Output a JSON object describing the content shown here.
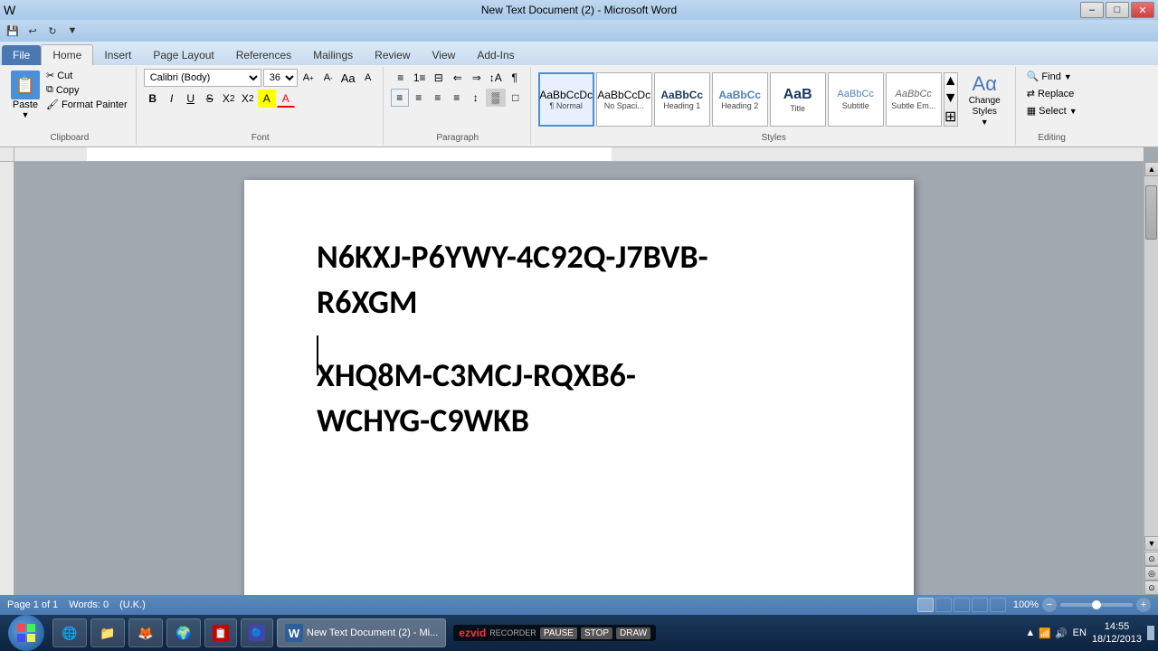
{
  "window": {
    "title": "New Text Document (2) - Microsoft Word",
    "min": "–",
    "max": "□",
    "close": "✕"
  },
  "quickaccess": {
    "items": [
      "💾",
      "↩",
      "↻",
      "▼"
    ]
  },
  "ribbon": {
    "tabs": [
      "File",
      "Home",
      "Insert",
      "Page Layout",
      "References",
      "Mailings",
      "Review",
      "View",
      "Add-Ins"
    ],
    "active_tab": "Home",
    "groups": {
      "clipboard": {
        "label": "Clipboard",
        "paste_label": "Paste",
        "cut": "Cut",
        "copy": "Copy",
        "format_painter": "Format Painter"
      },
      "font": {
        "label": "Font",
        "font_name": "Calibri (Body)",
        "font_size": "36",
        "grow": "A",
        "shrink": "a",
        "clear": "✕",
        "bold": "B",
        "italic": "I",
        "underline": "U",
        "strikethrough": "S",
        "subscript": "x₂",
        "superscript": "x²",
        "highlight": "A",
        "color": "A"
      },
      "paragraph": {
        "label": "Paragraph",
        "bullets": "☰",
        "numbering": "☷",
        "multilevel": "☰",
        "decrease_indent": "←",
        "increase_indent": "→",
        "sort": "↕",
        "show_hide": "¶",
        "align_left": "≡",
        "align_center": "≡",
        "align_right": "≡",
        "justify": "≡",
        "line_spacing": "↕",
        "shading": "▒",
        "borders": "□"
      },
      "styles": {
        "label": "Styles",
        "items": [
          {
            "label": "Normal",
            "preview": "AaBbCcDc",
            "active": true
          },
          {
            "label": "No Spaci...",
            "preview": "AaBbCcDc",
            "active": false
          },
          {
            "label": "Heading 1",
            "preview": "AaBbCc",
            "active": false
          },
          {
            "label": "Heading 2",
            "preview": "AaBbCc",
            "active": false
          },
          {
            "label": "Title",
            "preview": "AaB",
            "active": false
          },
          {
            "label": "Subtitle",
            "preview": "AaBbCc",
            "active": false
          },
          {
            "label": "Subtle Em...",
            "preview": "AaBbCc",
            "active": false
          }
        ],
        "change_styles": "Change\nStyles",
        "expand_arrow": "▼"
      },
      "editing": {
        "label": "Editing",
        "find": "Find",
        "replace": "Replace",
        "select": "Select"
      }
    }
  },
  "document": {
    "content_line1": "N6KXJ-P6YWY-4C92Q-J7BVB-",
    "content_line2": "R6XGM",
    "content_line3": "",
    "content_line4": "XHQ8M-C3MCJ-RQXB6-",
    "content_line5": "WCHYG-C9WKB"
  },
  "status": {
    "page": "Page 1 of 1",
    "words": "Words: 0",
    "language": "(U.K.)",
    "zoom": "100%"
  },
  "taskbar": {
    "apps": [
      {
        "icon": "🪟",
        "label": "Start"
      },
      {
        "icon": "🌐",
        "label": "IE"
      },
      {
        "icon": "📁",
        "label": "Explorer"
      },
      {
        "icon": "🔥",
        "label": "Firefox"
      },
      {
        "icon": "🌍",
        "label": "Chrome"
      },
      {
        "icon": "📋",
        "label": "Clipboard"
      },
      {
        "icon": "🔵",
        "label": "App"
      },
      {
        "icon": "W",
        "label": "Word",
        "active": true
      }
    ],
    "time": "14:55",
    "date": "18/12/2013",
    "language": "EN"
  },
  "ezvid": {
    "logo": "ezvid",
    "recorder_label": "RECORDER",
    "btn1": "PAUSE",
    "btn2": "STOP",
    "btn3": "DRAW"
  }
}
